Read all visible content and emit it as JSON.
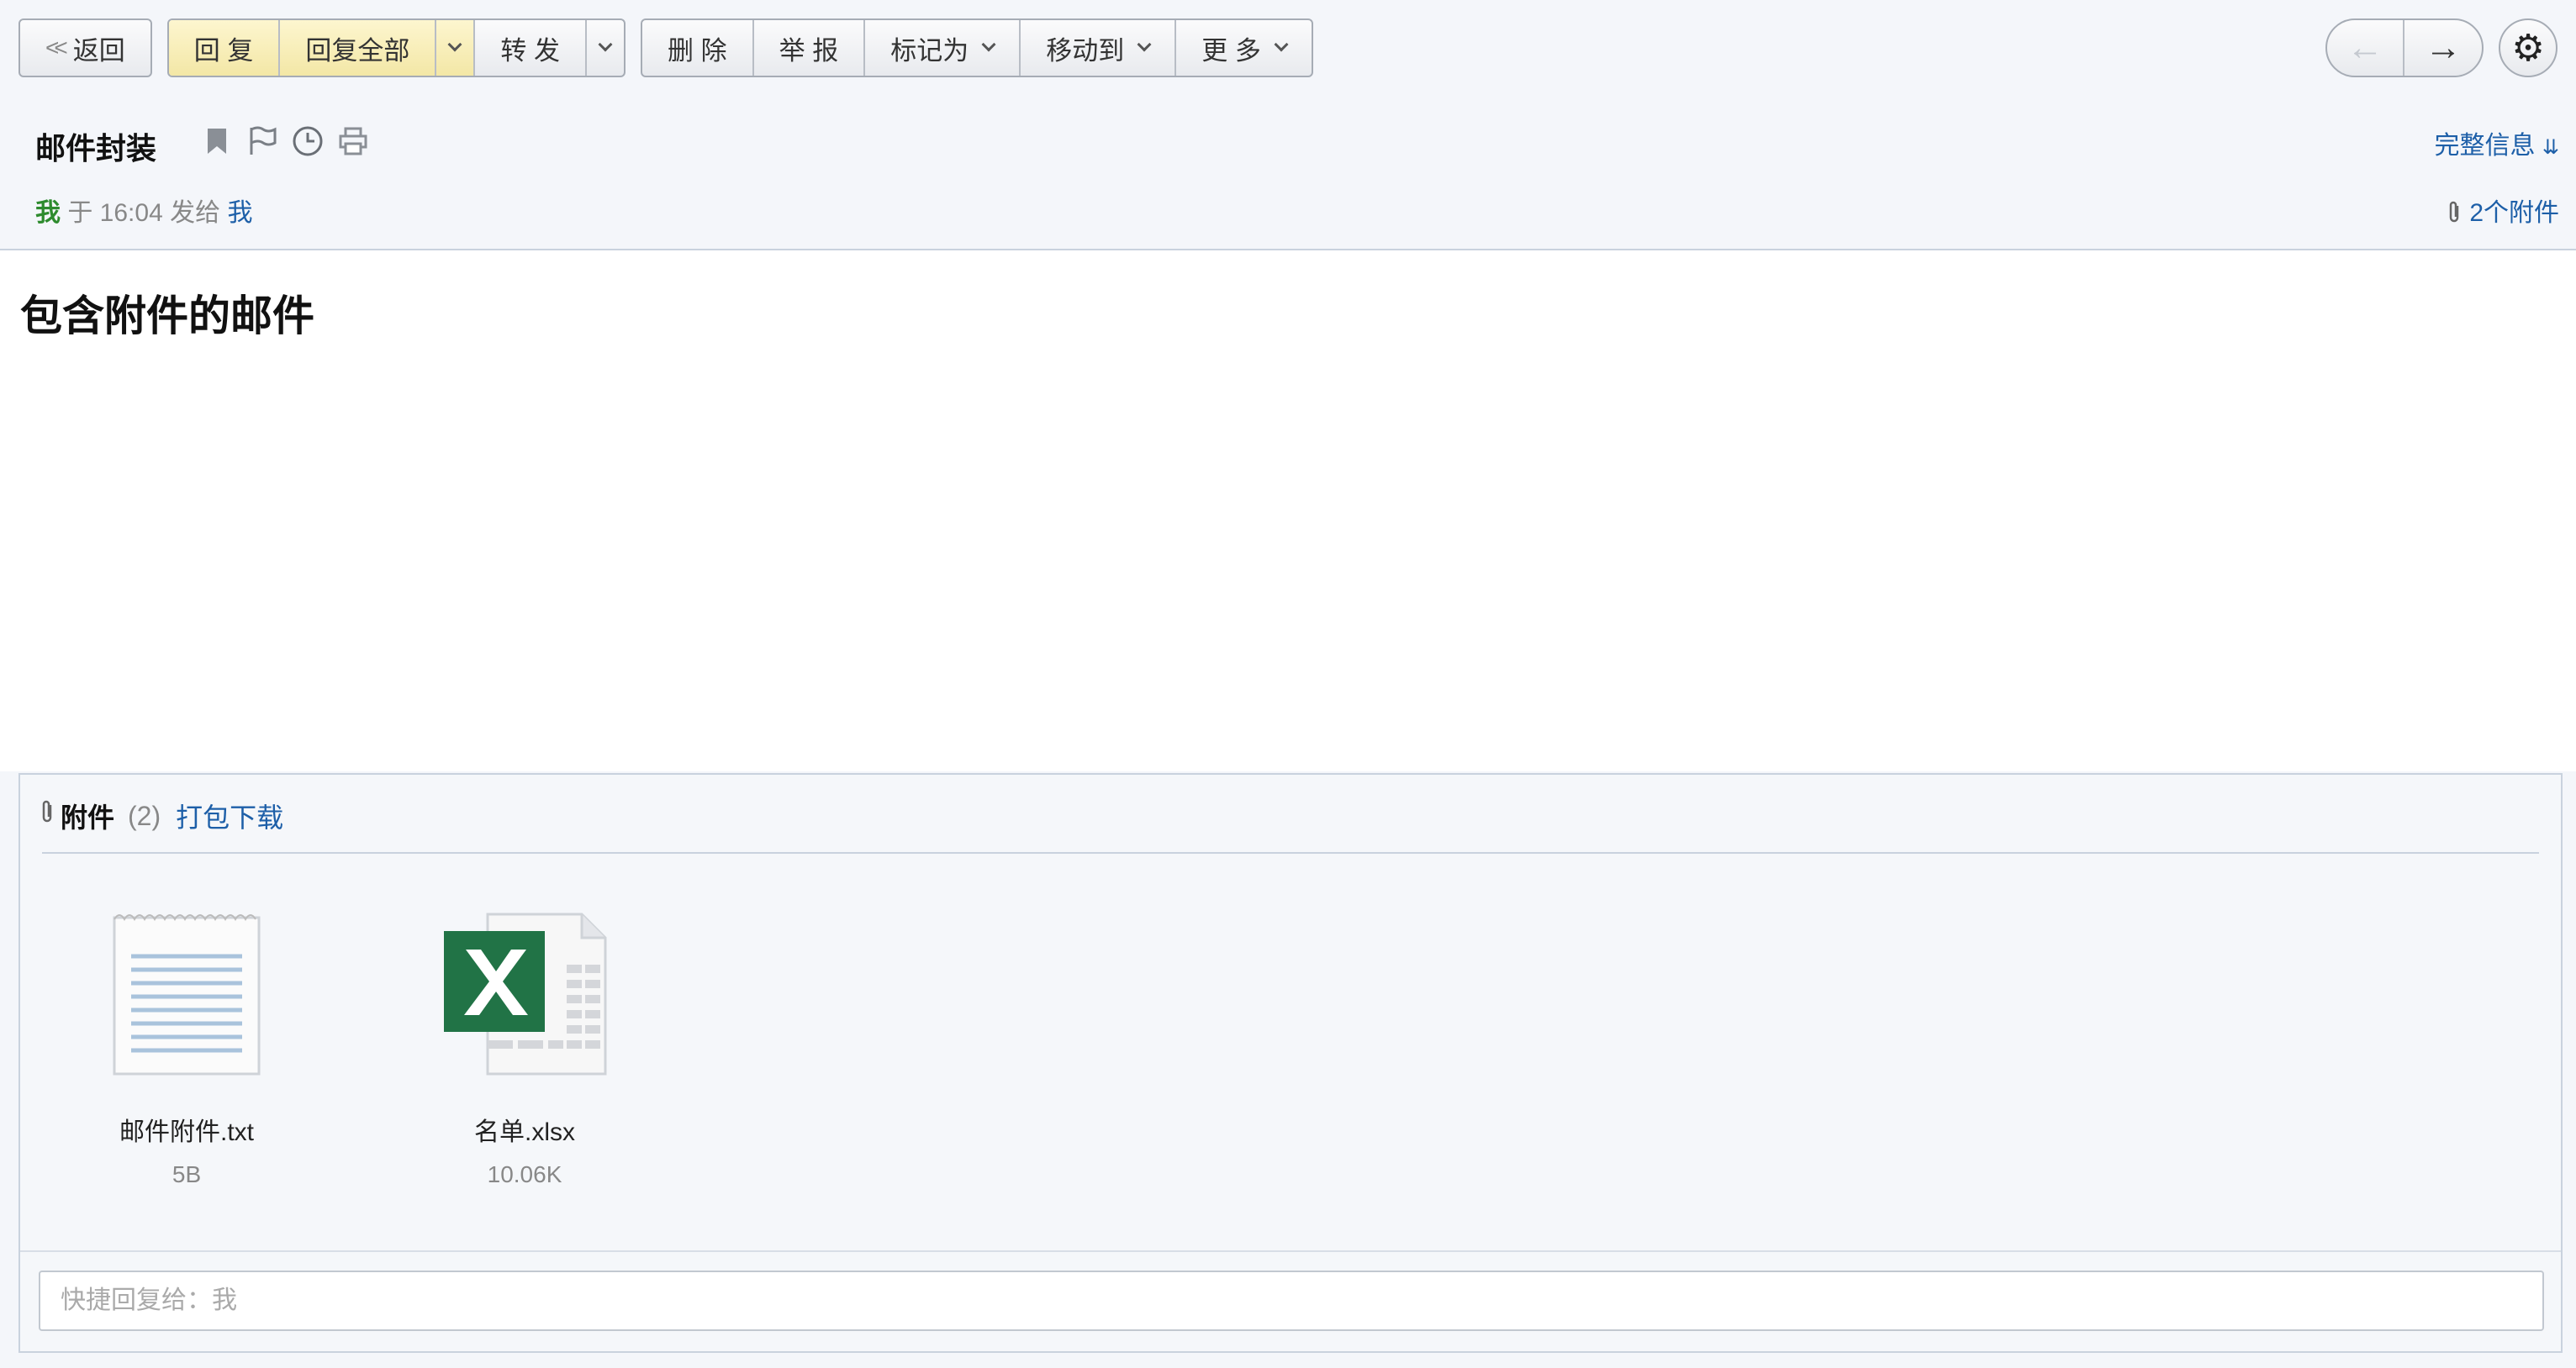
{
  "toolbar": {
    "back": "返回",
    "reply": "回 复",
    "reply_all": "回复全部",
    "forward": "转 发",
    "delete": "删 除",
    "report": "举 报",
    "mark_as": "标记为",
    "move_to": "移动到",
    "more": "更 多"
  },
  "nav": {
    "prev": "←",
    "next": "→",
    "settings": "⚙"
  },
  "mail": {
    "subject": "邮件封装",
    "full_info": "完整信息",
    "sender": "我",
    "sent_prefix": "于 16:04 发给",
    "recipient": "我",
    "attachment_summary": "2个附件",
    "body": "包含附件的邮件"
  },
  "attachments": {
    "title": "附件",
    "count": "(2)",
    "download_all": "打包下载",
    "files": [
      {
        "name": "邮件附件.txt",
        "size": "5B",
        "icon": "text-file-icon"
      },
      {
        "name": "名单.xlsx",
        "size": "10.06K",
        "icon": "excel-file-icon"
      }
    ]
  },
  "quick_reply": {
    "placeholder": "快捷回复给：我"
  },
  "colors": {
    "link": "#1d5fa8",
    "sender": "#2e8b2e",
    "excel": "#217346",
    "button_highlight": "#f6ebb2"
  }
}
